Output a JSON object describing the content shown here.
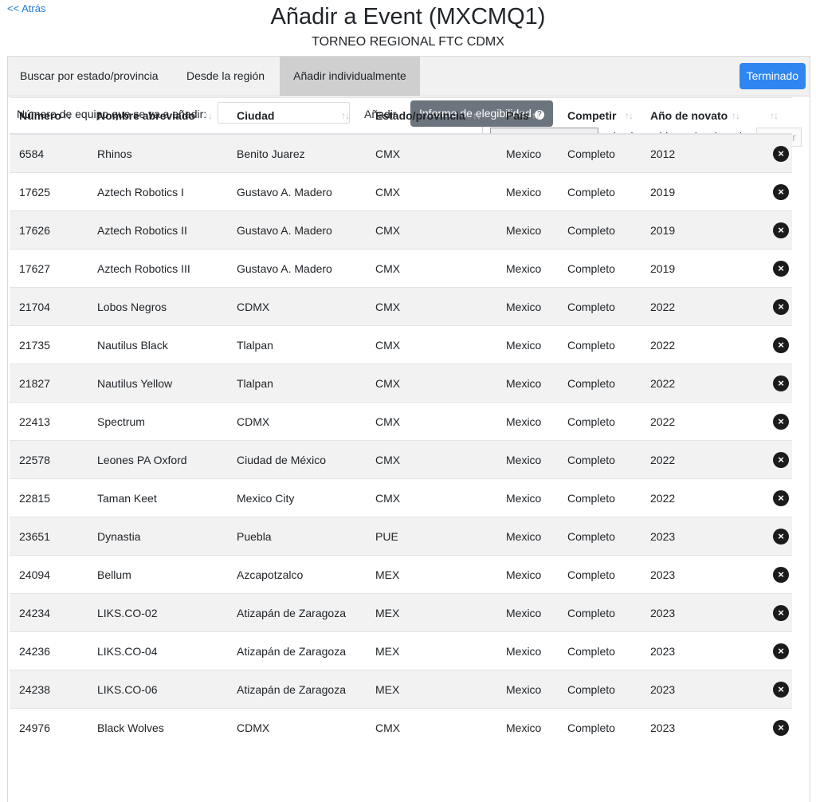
{
  "nav": {
    "back_label": "<< Atrás"
  },
  "header": {
    "title": "Añadir a Event (MXCMQ1)",
    "subtitle": "TORNEO REGIONAL FTC CDMX"
  },
  "tabs": [
    {
      "label": "Buscar por estado/provincia",
      "active": false
    },
    {
      "label": "Desde la región",
      "active": false
    },
    {
      "label": "Añadir individualmente",
      "active": true
    }
  ],
  "done_button": {
    "label": "Terminado"
  },
  "add_form": {
    "number_label": "Número de equipo que se va a añadir:",
    "number_value": "",
    "add_label": "Añadir",
    "eligibility_label": "Informe de elegibilidad",
    "help_icon": "question-circle-icon"
  },
  "file_upload": {
    "choose_label": "Seleccionar archivo",
    "status": "ningún archivo seleccionado",
    "upload_label": "Cargar"
  },
  "table": {
    "columns": [
      "Número",
      "Nombre abreviado",
      "Ciudad",
      "Estado/provincia",
      "País",
      "Competir",
      "Año de novato",
      ""
    ],
    "sort_icon": "sort-arrows-icon",
    "delete_icon": "close-circle-icon",
    "rows": [
      [
        "6584",
        "Rhinos",
        "Benito Juarez",
        "CMX",
        "Mexico",
        "Completo",
        "2012"
      ],
      [
        "17625",
        "Aztech Robotics I",
        "Gustavo A. Madero",
        "CMX",
        "Mexico",
        "Completo",
        "2019"
      ],
      [
        "17626",
        "Aztech Robotics II",
        "Gustavo A. Madero",
        "CMX",
        "Mexico",
        "Completo",
        "2019"
      ],
      [
        "17627",
        "Aztech Robotics III",
        "Gustavo A. Madero",
        "CMX",
        "Mexico",
        "Completo",
        "2019"
      ],
      [
        "21704",
        "Lobos Negros",
        "CDMX",
        "CMX",
        "Mexico",
        "Completo",
        "2022"
      ],
      [
        "21735",
        "Nautilus Black",
        "Tlalpan",
        "CMX",
        "Mexico",
        "Completo",
        "2022"
      ],
      [
        "21827",
        "Nautilus Yellow",
        "Tlalpan",
        "CMX",
        "Mexico",
        "Completo",
        "2022"
      ],
      [
        "22413",
        "Spectrum",
        "CDMX",
        "CMX",
        "Mexico",
        "Completo",
        "2022"
      ],
      [
        "22578",
        "Leones PA Oxford",
        "Ciudad de México",
        "CMX",
        "Mexico",
        "Completo",
        "2022"
      ],
      [
        "22815",
        "Taman Keet",
        "Mexico City",
        "CMX",
        "Mexico",
        "Completo",
        "2022"
      ],
      [
        "23651",
        "Dynastia",
        "Puebla",
        "PUE",
        "Mexico",
        "Completo",
        "2023"
      ],
      [
        "24094",
        "Bellum",
        "Azcapotzalco",
        "MEX",
        "Mexico",
        "Completo",
        "2023"
      ],
      [
        "24234",
        "LIKS.CO-02",
        "Atizapán de Zaragoza",
        "MEX",
        "Mexico",
        "Completo",
        "2023"
      ],
      [
        "24236",
        "LIKS.CO-04",
        "Atizapán de Zaragoza",
        "MEX",
        "Mexico",
        "Completo",
        "2023"
      ],
      [
        "24238",
        "LIKS.CO-06",
        "Atizapán de Zaragoza",
        "MEX",
        "Mexico",
        "Completo",
        "2023"
      ],
      [
        "24976",
        "Black Wolves",
        "CDMX",
        "CMX",
        "Mexico",
        "Completo",
        "2023"
      ]
    ]
  },
  "colors": {
    "link": "#1e7bd6",
    "primary_button": "#2f86f0",
    "secondary_button": "#6c757d",
    "active_tab": "#cfcfcf",
    "row_stripe": "#f2f2f2"
  }
}
